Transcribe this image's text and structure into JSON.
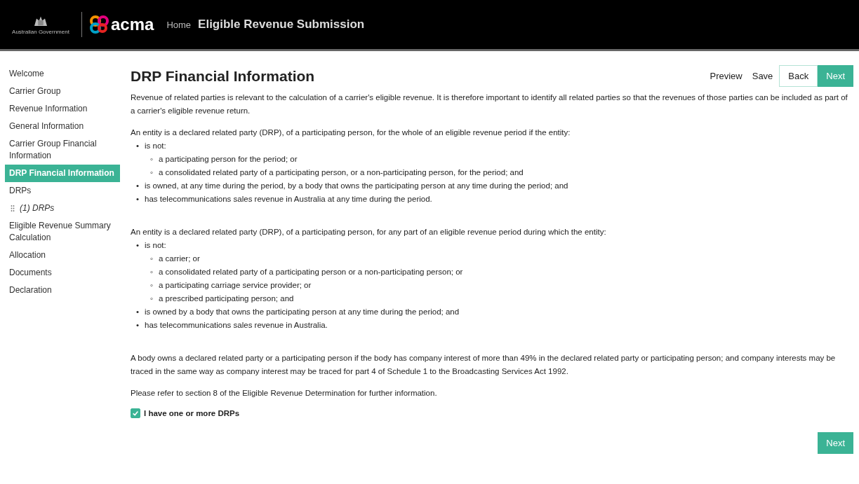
{
  "header": {
    "crest_caption": "Australian Government",
    "logo_text": "acma",
    "home_link": "Home",
    "title": "Eligible Revenue Submission"
  },
  "sidebar": {
    "items": [
      {
        "label": "Welcome",
        "selected": false
      },
      {
        "label": "Carrier Group",
        "selected": false
      },
      {
        "label": "Revenue Information",
        "selected": false
      },
      {
        "label": "General Information",
        "selected": false
      },
      {
        "label": "Carrier Group Financial Information",
        "selected": false
      },
      {
        "label": "DRP Financial Information",
        "selected": true
      },
      {
        "label": "DRPs",
        "selected": false,
        "children": [
          {
            "label": "(1) DRPs",
            "selected": false
          }
        ]
      },
      {
        "label": "Eligible Revenue Summary Calculation",
        "selected": false
      },
      {
        "label": "Allocation",
        "selected": false
      },
      {
        "label": "Documents",
        "selected": false
      },
      {
        "label": "Declaration",
        "selected": false
      }
    ]
  },
  "page": {
    "heading": "DRP Financial Information",
    "actions": [
      {
        "label": "Preview",
        "kind": "link"
      },
      {
        "label": "Save",
        "kind": "link"
      },
      {
        "label": "Back",
        "kind": "outline"
      },
      {
        "label": "Next",
        "kind": "primary"
      }
    ],
    "blocks": [
      {
        "kind": "paragraph",
        "text": "Revenue of related parties is relevant to the calculation of a carrier's eligible revenue. It is therefore important to identify all related parties so that the revenues of those parties can be included as part of a carrier's eligible revenue return."
      },
      {
        "kind": "paragraph",
        "text": "An entity is a declared related party (DRP), of a participating person, for the whole of an eligible revenue period if the entity:"
      },
      {
        "kind": "list",
        "items": [
          {
            "marker": "•",
            "text": "is not:",
            "children": [
              {
                "marker": "◦",
                "text": "a participating person for the period; or"
              },
              {
                "marker": "◦",
                "text": "a consolidated related party of a participating person, or a non-participating person, for the period; and"
              }
            ]
          },
          {
            "marker": "•",
            "text": "is owned, at any time during the period, by a body that owns the participating person at any time during the period; and"
          },
          {
            "marker": "•",
            "text": "has telecommunications sales revenue in Australia at any time during the period."
          }
        ]
      },
      {
        "kind": "paragraph",
        "text": "An entity is a declared related party (DRP), of a participating person, for any part of an eligible revenue period during which the entity:"
      },
      {
        "kind": "list",
        "items": [
          {
            "marker": "•",
            "text": "is not:",
            "children": [
              {
                "marker": "◦",
                "text": "a carrier; or"
              },
              {
                "marker": "◦",
                "text": "a consolidated related party of a participating person or a non-participating person; or"
              },
              {
                "marker": "◦",
                "text": "a participating carriage service provider; or"
              },
              {
                "marker": "◦",
                "text": "a prescribed participating person; and"
              }
            ]
          },
          {
            "marker": "•",
            "text": "is owned by a body that owns the participating person at any time during the period; and"
          },
          {
            "marker": "•",
            "text": "has telecommunications sales revenue in Australia."
          }
        ]
      },
      {
        "kind": "paragraph",
        "text": "A body owns a declared related party or a participating person if the body has company interest of more than 49% in the declared related party or participating person; and company interests may be traced in the same way as company interest may be traced for part 4 of Schedule 1 to the Broadcasting Services Act 1992."
      },
      {
        "kind": "paragraph",
        "text": "Please refer to section 8 of the Eligible Revenue Determination for further information."
      }
    ],
    "checkbox": {
      "label": "I have one or more DRPs",
      "checked": true
    },
    "bottom_button": "Next"
  }
}
